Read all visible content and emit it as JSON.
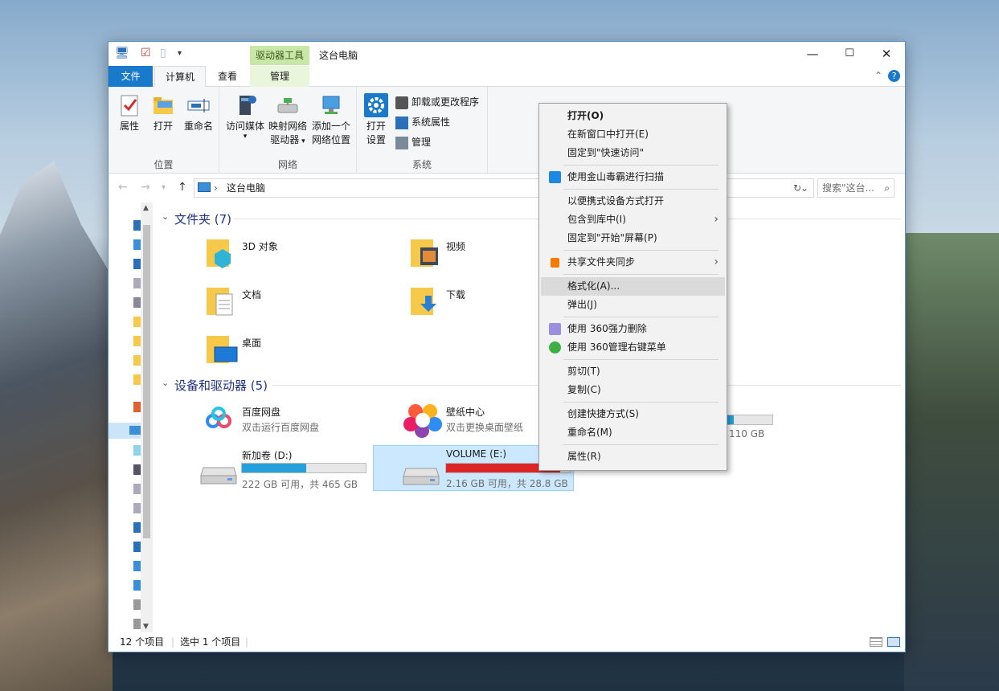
{
  "window": {
    "title": "这台电脑",
    "context_tab_header": "驱动器工具",
    "controls": {
      "minimize": "—",
      "maximize": "☐",
      "close": "✕"
    }
  },
  "tabs": [
    {
      "label": "文件"
    },
    {
      "label": "计算机"
    },
    {
      "label": "查看"
    },
    {
      "label": "管理"
    }
  ],
  "ribbon": {
    "groups": [
      {
        "label": "位置",
        "buttons": [
          "属性",
          "打开",
          "重命名"
        ]
      },
      {
        "label": "网络",
        "buttons": [
          "访问媒体",
          "映射网络",
          "驱动器",
          "添加一个",
          "网络位置"
        ]
      },
      {
        "label": "系统",
        "buttons": [
          "打开",
          "设置"
        ],
        "small": [
          "卸载或更改程序",
          "系统属性",
          "管理"
        ]
      }
    ]
  },
  "address": {
    "path": "这台电脑",
    "search_placeholder": "搜索\"这台..."
  },
  "folders": {
    "header": "文件夹 (7)",
    "items": [
      "3D 对象",
      "视频",
      "文档",
      "下载",
      "桌面"
    ]
  },
  "devices": {
    "header": "设备和驱动器 (5)",
    "items": [
      {
        "name": "百度网盘",
        "sub": "双击运行百度网盘"
      },
      {
        "name": "壁纸中心",
        "sub": "双击更换桌面壁纸"
      },
      {
        "name": "新加卷 (D:)",
        "sub": "222 GB 可用，共 465 GB",
        "used": 0.52,
        "bar_color": "#26a0da"
      },
      {
        "name": "VOLUME (E:)",
        "sub": "2.16 GB 可用，共 28.8 GB",
        "used": 0.925,
        "bar_color": "#da2626"
      },
      {
        "partial_sub": "110 GB",
        "used": 0.15,
        "bar_color": "#26a0da"
      }
    ]
  },
  "status": {
    "count": "12 个项目",
    "selected": "选中 1 个项目"
  },
  "context_menu": {
    "items": [
      "打开(O)",
      "在新窗口中打开(E)",
      "固定到\"快速访问\"",
      "使用金山毒霸进行扫描",
      "以便携式设备方式打开",
      "包含到库中(I)",
      "固定到\"开始\"屏幕(P)",
      "共享文件夹同步",
      "格式化(A)...",
      "弹出(J)",
      "使用 360强力删除",
      "使用 360管理右键菜单",
      "剪切(T)",
      "复制(C)",
      "创建快捷方式(S)",
      "重命名(M)",
      "属性(R)"
    ],
    "highlighted": "格式化(A)..."
  }
}
